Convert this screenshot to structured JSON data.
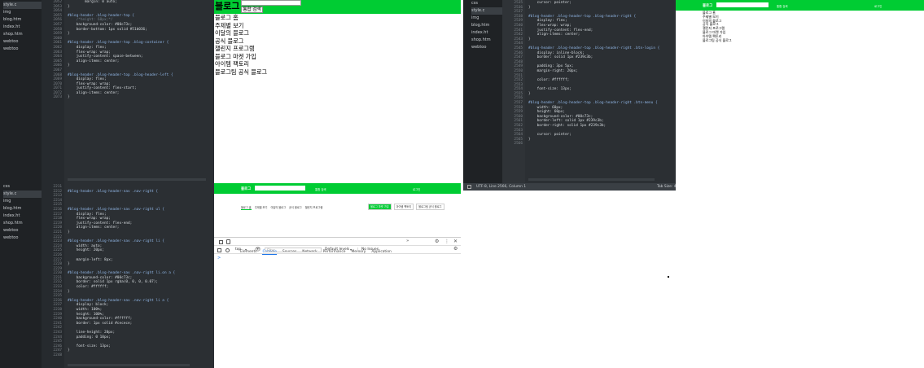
{
  "tl": {
    "tree": [
      {
        "label": "style.c",
        "active": true
      },
      {
        "label": "img"
      },
      {
        "label": "blog.htm"
      },
      {
        "label": "index.ht"
      },
      {
        "label": "shop.htm"
      },
      {
        "label": "webtoo"
      },
      {
        "label": "webtoo"
      }
    ],
    "gutter": [
      "2052",
      "2053",
      "2054",
      "2055",
      "2056",
      "2057",
      "2058",
      "2059",
      "2060",
      "2061",
      "2062",
      "2063",
      "2064",
      "2065",
      "2066",
      "2067",
      "2068",
      "2069",
      "2070",
      "2071",
      "2072",
      "2073"
    ],
    "code": [
      "        margin: 0 auto;",
      "}",
      "",
      "#blog-header .blog-header-top {",
      "    /*height: 60px;*/",
      "    background-color: #00c73c;",
      "    border-bottom: 1px solid #51b036;",
      "}",
      "",
      "#blog-header .blog-header-top .blog-container {",
      "    display: flex;",
      "    flex-wrap: wrap;",
      "    justify-content: space-between;",
      "    align-items: center;",
      "}",
      "",
      "#blog-header .blog-header-top .blog-header-left {",
      "    display: flex;",
      "    flex-wrap: wrap;",
      "    justify-content: flex-start;",
      "    align-items: center;",
      "}"
    ]
  },
  "bl": {
    "tree": [
      {
        "label": "css"
      },
      {
        "label": "style.c",
        "active": true
      },
      {
        "label": "img"
      },
      {
        "label": "blog.htm"
      },
      {
        "label": "index.ht"
      },
      {
        "label": "shop.htm"
      },
      {
        "label": "webtoo"
      },
      {
        "label": "webtoo"
      }
    ],
    "gutter": [
      "2211",
      "2212",
      "2213",
      "2214",
      "2215",
      "2216",
      "2217",
      "2218",
      "2219",
      "2220",
      "2221",
      "2222",
      "2223",
      "2224",
      "2225",
      "2226",
      "2227",
      "2228",
      "2229",
      "2230",
      "2231",
      "2232",
      "2233",
      "2234",
      "2235",
      "2236",
      "2237",
      "2238",
      "2239",
      "2240",
      "2241",
      "2242",
      "2243",
      "2244",
      "2245",
      "2246",
      "2247",
      "2248"
    ],
    "code": [
      "",
      "#blog-header .blog-header-nav .nav-right {",
      "",
      "",
      "",
      "#blog-header .blog-header-nav .nav-right ul {",
      "    display: flex;",
      "    flex-wrap: wrap;",
      "    justify-content: flex-end;",
      "    align-items: center;",
      "}",
      "",
      "#blog-header .blog-header-nav .nav-right li {",
      "    width: auto;",
      "    height: 20px;",
      "",
      "    margin-left: 8px;",
      "}",
      "",
      "#blog-header .blog-header-nav .nav-right li.on a {",
      "    background-color: #00c73c;",
      "    border: solid 1px rgba(0, 0, 0, 0.07);",
      "    color: #ffffff;",
      "}",
      "",
      "#blog-header .blog-header-nav .nav-right li a {",
      "    display: block;",
      "    width: 100%;",
      "    height: 100%;",
      "    background-color: #ffffff;",
      "    border: 1px solid #cecece;",
      "",
      "    line-height: 20px;",
      "    padding: 0 10px;",
      "",
      "    font-size: 13px;",
      "}",
      ""
    ]
  },
  "mid_top": {
    "logo": "블로그",
    "search_button": "통합 검색",
    "menu": [
      "블로그 홈",
      "주제별 보기",
      "이달의 블로그",
      "공식 블로그",
      "챌린지 프로그램",
      "블로그 마켓 가입",
      "아이템 팩토리",
      "블로그팀 공식 블로그"
    ]
  },
  "mid_bot": {
    "logo": "블로그",
    "search_button": "통합 검색",
    "login": "로그인",
    "nav_left": [
      "블로그 홈",
      "주제별 보기",
      "이달의 블로그",
      "공식 블로그",
      "챌린지 프로그램"
    ],
    "nav_right": [
      "블로그 마켓 가입",
      "아이템 팩토리",
      "블로그팀 공식 블로그"
    ],
    "devtools": {
      "tabs": [
        "Elements",
        "Console",
        "Sources",
        "Network",
        "Performance",
        "Memory",
        "Application"
      ],
      "more": "»",
      "context": "top",
      "filter_placeholder": "Filter",
      "levels": "Default levels",
      "issues": "No Issues",
      "prompt": ">"
    }
  },
  "tr": {
    "tree": [
      {
        "label": "css"
      },
      {
        "label": "style.c",
        "active": true
      },
      {
        "label": "img"
      },
      {
        "label": "blog.htm"
      },
      {
        "label": "index.ht"
      },
      {
        "label": "shop.htm"
      },
      {
        "label": "webtoo"
      }
    ],
    "gutter": [
      "2535",
      "2536",
      "2537",
      "2538",
      "2539",
      "2540",
      "2541",
      "2542",
      "2543",
      "2544",
      "2545",
      "2546",
      "2547",
      "2548",
      "2549",
      "2550",
      "2551",
      "2552",
      "2553",
      "2554",
      "2555",
      "2556",
      "2557",
      "2558",
      "2559",
      "2560",
      "2561",
      "2562",
      "2563",
      "2564",
      "2565",
      "2566"
    ],
    "code": [
      "    cursor: pointer;",
      "}",
      "",
      "#blog-header .blog-header-top .blog-header-right {",
      "    display: flex;",
      "    flex-wrap: wrap;",
      "    justify-content: flex-end;",
      "    align-items: center;",
      "}",
      "",
      "#blog-header .blog-header-top .blog-header-right .btn-login {",
      "    display: inline-block;",
      "    border: solid 1px #239c3b;",
      "",
      "    padding: 3px 5px;",
      "    margin-right: 20px;",
      "",
      "    color: #ffffff;",
      "",
      "    font-size: 13px;",
      "}",
      "",
      "#blog-header .blog-header-top .blog-header-right .btn-menu {",
      "    width: 60px;",
      "    height: 60px;",
      "    background-color: #00c73c;",
      "    border-left: solid 1px #239c3b;",
      "    border-right: solid 1px #239c3b;",
      "",
      "    cursor: pointer;",
      "}",
      ""
    ],
    "status_left": "UTF-8, Line 2566, Column 1",
    "status_right": "Tab Size: 4"
  },
  "right": {
    "logo": "블로그",
    "search_button": "통합 검색",
    "login": "로그인",
    "menu": [
      "블로그 홈",
      "주제별 보기",
      "이달의 블로그",
      "공식 블로그",
      "챌린지 프로그램",
      "블로그 마켓 가입",
      "아이템 팩토리",
      "블로그팀 공식 블로그"
    ]
  },
  "colors": {
    "green": "#00cc33",
    "editor_bg": "#2b2f33",
    "tree_bg": "#1f2225"
  }
}
